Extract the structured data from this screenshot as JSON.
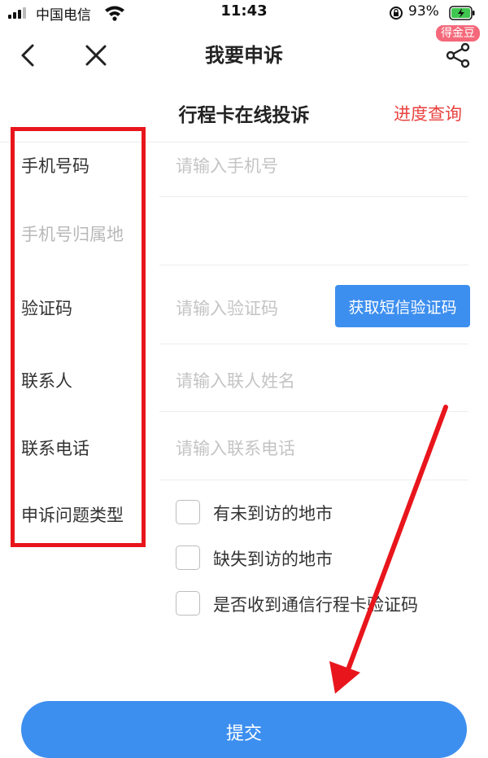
{
  "status_bar": {
    "carrier": "中国电信",
    "time": "11:43",
    "battery": "93%"
  },
  "nav": {
    "title": "我要申诉",
    "badge": "得金豆"
  },
  "header": {
    "subtitle": "行程卡在线投诉",
    "progress_link": "进度查询"
  },
  "form": {
    "phone_label": "手机号码",
    "phone_placeholder": "请输入手机号",
    "phone_region_label": "手机号归属地",
    "code_label": "验证码",
    "code_placeholder": "请输入验证码",
    "sms_button": "获取短信验证码",
    "contact_label": "联系人",
    "contact_placeholder": "请输入联人姓名",
    "contact_phone_label": "联系电话",
    "contact_phone_placeholder": "请输入联系电话",
    "issue_type_label": "申诉问题类型",
    "options": [
      "有未到访的地市",
      "缺失到访的地市",
      "是否收到通信行程卡验证码"
    ]
  },
  "submit_label": "提交",
  "colors": {
    "accent": "#3d8fef",
    "link_red": "#e8423f",
    "highlight_red": "#e8161c",
    "badge": "#f4687a"
  },
  "icons": [
    "signal-icon",
    "wifi-icon",
    "rotation-lock-icon",
    "battery-charging-icon",
    "back-icon",
    "close-icon",
    "share-icon"
  ]
}
